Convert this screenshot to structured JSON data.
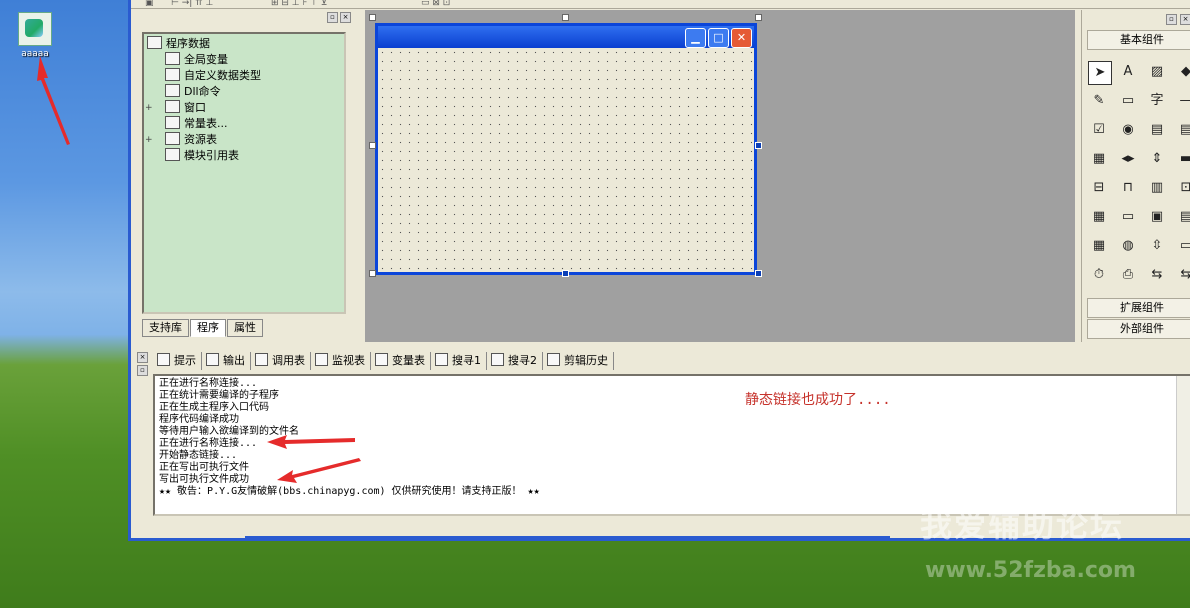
{
  "desktop": {
    "icon_label": "aaaaa"
  },
  "tree": {
    "items": [
      {
        "label": "程序数据",
        "indent": 0,
        "expander": ""
      },
      {
        "label": "全局变量",
        "indent": 1,
        "expander": ""
      },
      {
        "label": "自定义数据类型",
        "indent": 1,
        "expander": ""
      },
      {
        "label": "Dll命令",
        "indent": 1,
        "expander": ""
      },
      {
        "label": "窗口",
        "indent": 1,
        "expander": "+"
      },
      {
        "label": "常量表...",
        "indent": 1,
        "expander": ""
      },
      {
        "label": "资源表",
        "indent": 1,
        "expander": "+"
      },
      {
        "label": "模块引用表",
        "indent": 1,
        "expander": ""
      }
    ]
  },
  "left_tabs": [
    "支持库",
    "程序",
    "属性"
  ],
  "right_panel": {
    "basic_label": "基本组件",
    "extended_label": "扩展组件",
    "external_label": "外部组件",
    "zi_glyph": "字"
  },
  "bottom_tabs": [
    "提示",
    "输出",
    "调用表",
    "监视表",
    "变量表",
    "搜寻1",
    "搜寻2",
    "剪辑历史"
  ],
  "output": {
    "lines": [
      "正在进行名称连接...",
      "正在统计需要编译的子程序",
      "正在生成主程序入口代码",
      "程序代码编译成功",
      "等待用户输入欲编译到的文件名",
      "正在进行名称连接...",
      "开始静态链接...",
      "正在写出可执行文件",
      "写出可执行文件成功",
      "★★ 敬告：P.Y.G友情破解(bbs.chinapyg.com) 仅供研究使用！请支持正版！ ★★"
    ],
    "annotation": "静态链接也成功了...."
  },
  "watermark": {
    "cn": "我爱辅助论坛",
    "url": "www.52fzba.com"
  }
}
